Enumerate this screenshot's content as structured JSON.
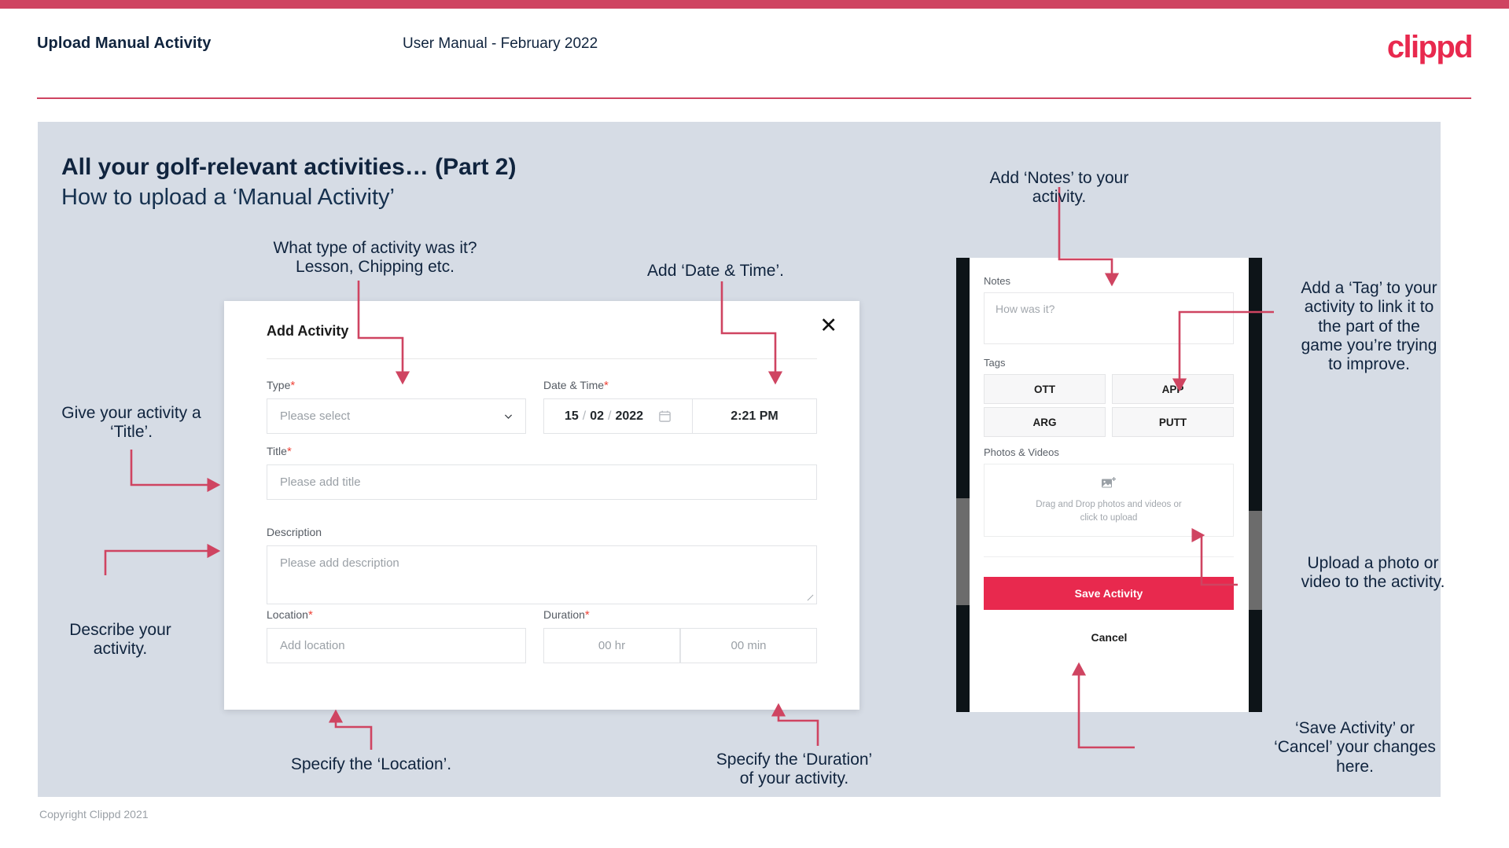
{
  "brand": {
    "logo_text": "clippd",
    "accent": "#e8294e",
    "bar": "#cf4461",
    "panel_bg": "#d6dce5"
  },
  "header": {
    "title": "Upload Manual Activity",
    "subtitle": "User Manual - February 2022"
  },
  "slide": {
    "title": "All your golf-relevant activities… (Part 2)",
    "subtitle": "How to upload a ‘Manual Activity’"
  },
  "dialog": {
    "title": "Add Activity",
    "close_icon": "close-icon",
    "fields": {
      "type": {
        "label": "Type",
        "required": "*",
        "placeholder": "Please select"
      },
      "datetime": {
        "label": "Date & Time",
        "required": "*",
        "day": "15",
        "sep": "/",
        "month": "02",
        "year": "2022",
        "time": "2:21 PM"
      },
      "title": {
        "label": "Title",
        "required": "*",
        "placeholder": "Please add title"
      },
      "description": {
        "label": "Description",
        "placeholder": "Please add description"
      },
      "location": {
        "label": "Location",
        "required": "*",
        "placeholder": "Add location"
      },
      "duration": {
        "label": "Duration",
        "required": "*",
        "hours": "00 hr",
        "minutes": "00 min"
      }
    }
  },
  "phone": {
    "notes": {
      "label": "Notes",
      "placeholder": "How was it?"
    },
    "tags": {
      "label": "Tags",
      "items": [
        "OTT",
        "APP",
        "ARG",
        "PUTT"
      ]
    },
    "photos": {
      "label": "Photos & Videos",
      "dropzone_line1": "Drag and Drop photos and videos or",
      "dropzone_line2": "click to upload"
    },
    "save_label": "Save Activity",
    "cancel_label": "Cancel"
  },
  "annotations": {
    "type": "What type of activity was it?\nLesson, Chipping etc.",
    "datetime": "Add ‘Date & Time’.",
    "title": "Give your activity a\n‘Title’.",
    "description": "Describe your\nactivity.",
    "location": "Specify the ‘Location’.",
    "duration": "Specify the ‘Duration’\nof your activity.",
    "notes": "Add ‘Notes’ to your\nactivity.",
    "tags": "Add a ‘Tag’ to your\nactivity to link it to\nthe part of the\ngame you’re trying\nto improve.",
    "upload": "Upload a photo or\nvideo to the activity.",
    "save": "‘Save Activity’ or\n‘Cancel’ your changes\nhere."
  },
  "footer": {
    "copyright": "Copyright Clippd 2021"
  }
}
